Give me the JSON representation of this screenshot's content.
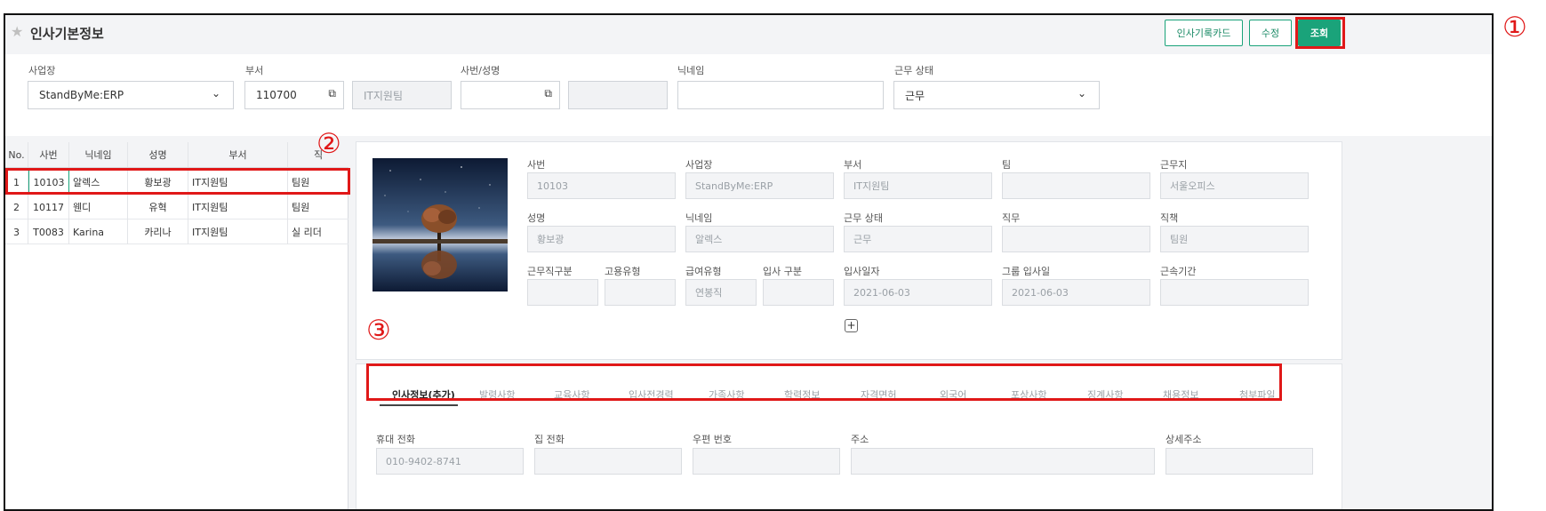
{
  "header": {
    "title": "인사기본정보",
    "buttons": {
      "card": "인사기록카드",
      "edit": "수정",
      "search": "조회"
    }
  },
  "filter": {
    "site": {
      "label": "사업장",
      "value": "StandByMe:ERP"
    },
    "dept": {
      "label": "부서",
      "code": "110700",
      "name": "IT지원팀"
    },
    "emp": {
      "label": "사번/성명",
      "value": "",
      "name": ""
    },
    "nickname": {
      "label": "닉네임",
      "value": ""
    },
    "status": {
      "label": "근무 상태",
      "value": "근무"
    }
  },
  "list": {
    "columns": [
      "No.",
      "사번",
      "닉네임",
      "성명",
      "부서",
      "직"
    ],
    "rows": [
      {
        "no": "1",
        "id": "10103",
        "nick": "알렉스",
        "name": "황보광",
        "dept": "IT지원팀",
        "pos": "팀원"
      },
      {
        "no": "2",
        "id": "10117",
        "nick": "웬디",
        "name": "유혁",
        "dept": "IT지원팀",
        "pos": "팀원"
      },
      {
        "no": "3",
        "id": "T0083",
        "nick": "Karina",
        "name": "카리나",
        "dept": "IT지원팀",
        "pos": "실 리더"
      }
    ]
  },
  "detail": {
    "empno": {
      "label": "사번",
      "value": "10103"
    },
    "site": {
      "label": "사업장",
      "value": "StandByMe:ERP"
    },
    "dept": {
      "label": "부서",
      "value": "IT지원팀"
    },
    "team": {
      "label": "팀",
      "value": ""
    },
    "workplace": {
      "label": "근무지",
      "value": "서울오피스"
    },
    "name": {
      "label": "성명",
      "value": "황보광"
    },
    "nickname": {
      "label": "닉네임",
      "value": "알렉스"
    },
    "status": {
      "label": "근무 상태",
      "value": "근무"
    },
    "duty": {
      "label": "직무",
      "value": ""
    },
    "position": {
      "label": "직책",
      "value": "팀원"
    },
    "worktype": {
      "label": "근무직구분",
      "value": ""
    },
    "emptype": {
      "label": "고용유형",
      "value": ""
    },
    "paytype": {
      "label": "급여유형",
      "value": "연봉직"
    },
    "jointype": {
      "label": "입사 구분",
      "value": ""
    },
    "joindate": {
      "label": "입사일자",
      "value": "2021-06-03"
    },
    "groupjoin": {
      "label": "그룹 입사일",
      "value": "2021-06-03"
    },
    "tenure": {
      "label": "근속기간",
      "value": ""
    }
  },
  "tabs": [
    "인사정보(추가)",
    "발령사항",
    "교육사항",
    "입사전경력",
    "가족사항",
    "학력정보",
    "자격면허",
    "외국어",
    "포상사항",
    "징계사항",
    "채용정보",
    "첨부파일"
  ],
  "tab_fields": {
    "mobile": {
      "label": "휴대 전화",
      "value": "010-9402-8741"
    },
    "home": {
      "label": "집 전화",
      "value": ""
    },
    "zip": {
      "label": "우편 번호",
      "value": ""
    },
    "address": {
      "label": "주소",
      "value": ""
    },
    "address2": {
      "label": "상세주소",
      "value": ""
    }
  },
  "annotations": [
    "①",
    "②",
    "③"
  ],
  "colors": {
    "accent": "#1aa37a",
    "highlight": "#e01818"
  },
  "icons": {
    "star": "star-icon",
    "chevron": "chevron-down-icon",
    "copy": "copy-icon",
    "plus": "plus-icon"
  }
}
